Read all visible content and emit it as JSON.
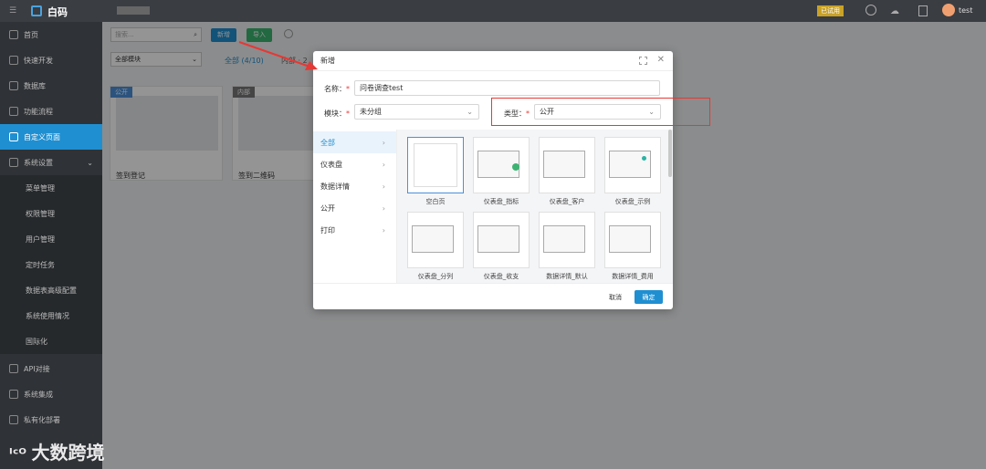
{
  "app": {
    "logo": "白码",
    "user": "test",
    "badge": "已试用"
  },
  "sidebar": {
    "items": [
      {
        "label": "首页",
        "icon": "home-icon"
      },
      {
        "label": "快速开发",
        "icon": "rocket-icon"
      },
      {
        "label": "数据库",
        "icon": "database-icon"
      },
      {
        "label": "功能流程",
        "icon": "flow-icon"
      },
      {
        "label": "自定义页面",
        "icon": "page-icon",
        "active": true
      },
      {
        "label": "系统设置",
        "icon": "settings-icon"
      }
    ],
    "subitems": [
      "菜单管理",
      "权限管理",
      "用户管理",
      "定时任务",
      "数据表高级配置",
      "系统使用情况",
      "国际化"
    ],
    "bottom": [
      {
        "label": "API对接"
      },
      {
        "label": "系统集成"
      },
      {
        "label": "私有化部署"
      }
    ]
  },
  "toolbar": {
    "search_placeholder": "搜索...",
    "new_label": "新增",
    "import_label": "导入",
    "module_select": "全部模块",
    "tab_all": "全部 (4/10)",
    "tab_other": "内部 · 2"
  },
  "cards": [
    {
      "tag": "公开",
      "title": "签到登记"
    },
    {
      "tag": "内部",
      "title": "签到二维码"
    }
  ],
  "modal": {
    "title": "新增",
    "name_label": "名称：",
    "name_value": "问卷调查test",
    "module_label": "模块：",
    "module_value": "未分组",
    "type_label": "类型：",
    "type_value": "公开",
    "categories": [
      "全部",
      "仪表盘",
      "数据详情",
      "公开",
      "打印"
    ],
    "templates": [
      "空白页",
      "仪表盘_指标",
      "仪表盘_客户",
      "仪表盘_示例",
      "仪表盘_分列",
      "仪表盘_收支",
      "数据详情_默认",
      "数据详情_费用"
    ],
    "cancel_label": "取消",
    "ok_label": "确定"
  },
  "watermark": "大数跨境",
  "colors": {
    "accent": "#1f8fd1",
    "highlight": "#e53935"
  }
}
